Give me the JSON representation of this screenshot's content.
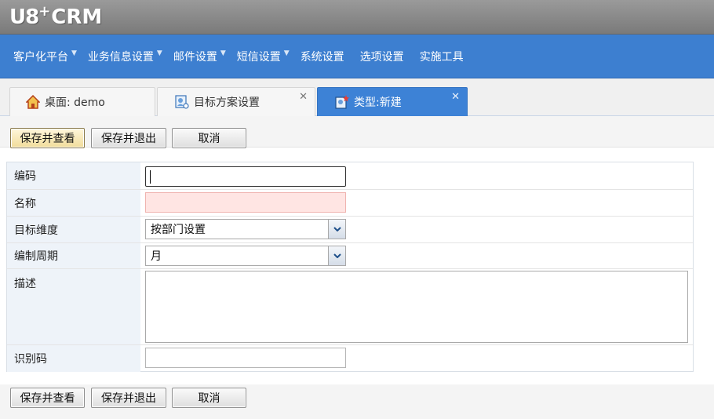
{
  "app": {
    "logo_u8": "U8",
    "logo_plus": "+",
    "logo_crm": "CRM"
  },
  "menubar": {
    "items": [
      {
        "label": "客户化平台",
        "has_dropdown": true
      },
      {
        "label": "业务信息设置",
        "has_dropdown": true
      },
      {
        "label": "邮件设置",
        "has_dropdown": true
      },
      {
        "label": "短信设置",
        "has_dropdown": true
      },
      {
        "label": "系统设置",
        "has_dropdown": false
      },
      {
        "label": "选项设置",
        "has_dropdown": false
      },
      {
        "label": "实施工具",
        "has_dropdown": false
      }
    ]
  },
  "tabs": [
    {
      "label": "桌面: demo",
      "icon": "home-icon",
      "closable": false,
      "active": false
    },
    {
      "label": "目标方案设置",
      "icon": "target-plan-icon",
      "closable": true,
      "active": false
    },
    {
      "label": "类型:新建",
      "icon": "new-type-icon",
      "closable": true,
      "active": true
    }
  ],
  "toolbar": {
    "save_view_label": "保存并查看",
    "save_exit_label": "保存并退出",
    "cancel_label": "取消"
  },
  "form": {
    "code_label": "编码",
    "code_value": "",
    "name_label": "名称",
    "name_value": "",
    "dimension_label": "目标维度",
    "dimension_value": "按部门设置",
    "period_label": "编制周期",
    "period_value": "月",
    "description_label": "描述",
    "description_value": "",
    "identifier_label": "识别码",
    "identifier_value": ""
  },
  "colors": {
    "header_gray": "#8a8a8a",
    "menubar_blue": "#3d7fd0",
    "active_tab_blue": "#3d82d6",
    "required_field_pink": "#ffe5e3",
    "label_bg": "#eef3f9"
  },
  "close_glyph": "✕"
}
